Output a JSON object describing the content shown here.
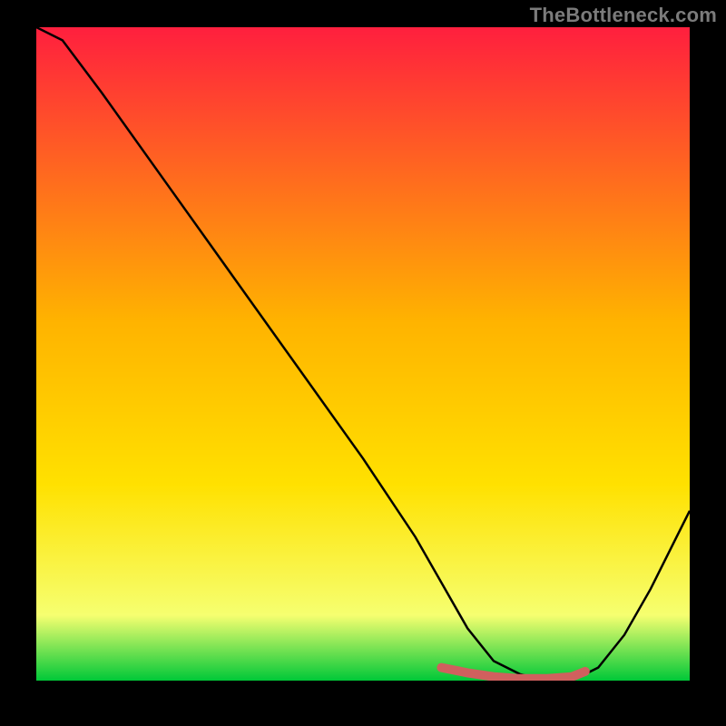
{
  "branding": {
    "logo": "TheBottleneck.com"
  },
  "chart_data": {
    "type": "line",
    "title": "",
    "xlabel": "",
    "ylabel": "",
    "xlim": [
      0,
      100
    ],
    "ylim": [
      0,
      100
    ],
    "grid": false,
    "legend": false,
    "background_gradient": {
      "top": "#ff1f3e",
      "mid1": "#ffb300",
      "mid2": "#ffe100",
      "mid3": "#f6ff70",
      "bottom": "#00c838"
    },
    "series": [
      {
        "name": "bottleneck-curve",
        "color": "#000000",
        "x": [
          0,
          4,
          10,
          20,
          30,
          40,
          50,
          58,
          62,
          66,
          70,
          74,
          78,
          82,
          86,
          90,
          94,
          98,
          100
        ],
        "values": [
          100,
          98,
          90,
          76,
          62,
          48,
          34,
          22,
          15,
          8,
          3,
          1,
          0,
          0,
          2,
          7,
          14,
          22,
          26
        ]
      },
      {
        "name": "highlight-valley",
        "color": "#d0605e",
        "x": [
          62,
          66,
          70,
          74,
          78,
          82,
          84
        ],
        "values": [
          2,
          1.2,
          0.6,
          0.3,
          0.3,
          0.6,
          1.4
        ]
      }
    ]
  }
}
